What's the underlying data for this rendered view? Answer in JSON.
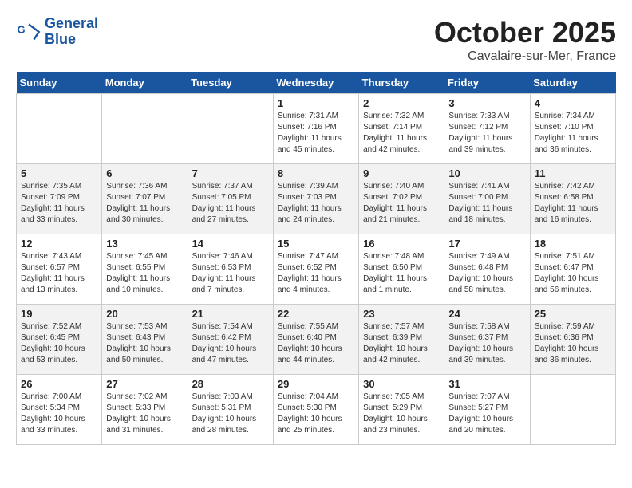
{
  "header": {
    "logo_line1": "General",
    "logo_line2": "Blue",
    "month": "October 2025",
    "location": "Cavalaire-sur-Mer, France"
  },
  "weekdays": [
    "Sunday",
    "Monday",
    "Tuesday",
    "Wednesday",
    "Thursday",
    "Friday",
    "Saturday"
  ],
  "weeks": [
    [
      {
        "day": "",
        "sunrise": "",
        "sunset": "",
        "daylight": ""
      },
      {
        "day": "",
        "sunrise": "",
        "sunset": "",
        "daylight": ""
      },
      {
        "day": "",
        "sunrise": "",
        "sunset": "",
        "daylight": ""
      },
      {
        "day": "1",
        "sunrise": "Sunrise: 7:31 AM",
        "sunset": "Sunset: 7:16 PM",
        "daylight": "Daylight: 11 hours and 45 minutes."
      },
      {
        "day": "2",
        "sunrise": "Sunrise: 7:32 AM",
        "sunset": "Sunset: 7:14 PM",
        "daylight": "Daylight: 11 hours and 42 minutes."
      },
      {
        "day": "3",
        "sunrise": "Sunrise: 7:33 AM",
        "sunset": "Sunset: 7:12 PM",
        "daylight": "Daylight: 11 hours and 39 minutes."
      },
      {
        "day": "4",
        "sunrise": "Sunrise: 7:34 AM",
        "sunset": "Sunset: 7:10 PM",
        "daylight": "Daylight: 11 hours and 36 minutes."
      }
    ],
    [
      {
        "day": "5",
        "sunrise": "Sunrise: 7:35 AM",
        "sunset": "Sunset: 7:09 PM",
        "daylight": "Daylight: 11 hours and 33 minutes."
      },
      {
        "day": "6",
        "sunrise": "Sunrise: 7:36 AM",
        "sunset": "Sunset: 7:07 PM",
        "daylight": "Daylight: 11 hours and 30 minutes."
      },
      {
        "day": "7",
        "sunrise": "Sunrise: 7:37 AM",
        "sunset": "Sunset: 7:05 PM",
        "daylight": "Daylight: 11 hours and 27 minutes."
      },
      {
        "day": "8",
        "sunrise": "Sunrise: 7:39 AM",
        "sunset": "Sunset: 7:03 PM",
        "daylight": "Daylight: 11 hours and 24 minutes."
      },
      {
        "day": "9",
        "sunrise": "Sunrise: 7:40 AM",
        "sunset": "Sunset: 7:02 PM",
        "daylight": "Daylight: 11 hours and 21 minutes."
      },
      {
        "day": "10",
        "sunrise": "Sunrise: 7:41 AM",
        "sunset": "Sunset: 7:00 PM",
        "daylight": "Daylight: 11 hours and 18 minutes."
      },
      {
        "day": "11",
        "sunrise": "Sunrise: 7:42 AM",
        "sunset": "Sunset: 6:58 PM",
        "daylight": "Daylight: 11 hours and 16 minutes."
      }
    ],
    [
      {
        "day": "12",
        "sunrise": "Sunrise: 7:43 AM",
        "sunset": "Sunset: 6:57 PM",
        "daylight": "Daylight: 11 hours and 13 minutes."
      },
      {
        "day": "13",
        "sunrise": "Sunrise: 7:45 AM",
        "sunset": "Sunset: 6:55 PM",
        "daylight": "Daylight: 11 hours and 10 minutes."
      },
      {
        "day": "14",
        "sunrise": "Sunrise: 7:46 AM",
        "sunset": "Sunset: 6:53 PM",
        "daylight": "Daylight: 11 hours and 7 minutes."
      },
      {
        "day": "15",
        "sunrise": "Sunrise: 7:47 AM",
        "sunset": "Sunset: 6:52 PM",
        "daylight": "Daylight: 11 hours and 4 minutes."
      },
      {
        "day": "16",
        "sunrise": "Sunrise: 7:48 AM",
        "sunset": "Sunset: 6:50 PM",
        "daylight": "Daylight: 11 hours and 1 minute."
      },
      {
        "day": "17",
        "sunrise": "Sunrise: 7:49 AM",
        "sunset": "Sunset: 6:48 PM",
        "daylight": "Daylight: 10 hours and 58 minutes."
      },
      {
        "day": "18",
        "sunrise": "Sunrise: 7:51 AM",
        "sunset": "Sunset: 6:47 PM",
        "daylight": "Daylight: 10 hours and 56 minutes."
      }
    ],
    [
      {
        "day": "19",
        "sunrise": "Sunrise: 7:52 AM",
        "sunset": "Sunset: 6:45 PM",
        "daylight": "Daylight: 10 hours and 53 minutes."
      },
      {
        "day": "20",
        "sunrise": "Sunrise: 7:53 AM",
        "sunset": "Sunset: 6:43 PM",
        "daylight": "Daylight: 10 hours and 50 minutes."
      },
      {
        "day": "21",
        "sunrise": "Sunrise: 7:54 AM",
        "sunset": "Sunset: 6:42 PM",
        "daylight": "Daylight: 10 hours and 47 minutes."
      },
      {
        "day": "22",
        "sunrise": "Sunrise: 7:55 AM",
        "sunset": "Sunset: 6:40 PM",
        "daylight": "Daylight: 10 hours and 44 minutes."
      },
      {
        "day": "23",
        "sunrise": "Sunrise: 7:57 AM",
        "sunset": "Sunset: 6:39 PM",
        "daylight": "Daylight: 10 hours and 42 minutes."
      },
      {
        "day": "24",
        "sunrise": "Sunrise: 7:58 AM",
        "sunset": "Sunset: 6:37 PM",
        "daylight": "Daylight: 10 hours and 39 minutes."
      },
      {
        "day": "25",
        "sunrise": "Sunrise: 7:59 AM",
        "sunset": "Sunset: 6:36 PM",
        "daylight": "Daylight: 10 hours and 36 minutes."
      }
    ],
    [
      {
        "day": "26",
        "sunrise": "Sunrise: 7:00 AM",
        "sunset": "Sunset: 5:34 PM",
        "daylight": "Daylight: 10 hours and 33 minutes."
      },
      {
        "day": "27",
        "sunrise": "Sunrise: 7:02 AM",
        "sunset": "Sunset: 5:33 PM",
        "daylight": "Daylight: 10 hours and 31 minutes."
      },
      {
        "day": "28",
        "sunrise": "Sunrise: 7:03 AM",
        "sunset": "Sunset: 5:31 PM",
        "daylight": "Daylight: 10 hours and 28 minutes."
      },
      {
        "day": "29",
        "sunrise": "Sunrise: 7:04 AM",
        "sunset": "Sunset: 5:30 PM",
        "daylight": "Daylight: 10 hours and 25 minutes."
      },
      {
        "day": "30",
        "sunrise": "Sunrise: 7:05 AM",
        "sunset": "Sunset: 5:29 PM",
        "daylight": "Daylight: 10 hours and 23 minutes."
      },
      {
        "day": "31",
        "sunrise": "Sunrise: 7:07 AM",
        "sunset": "Sunset: 5:27 PM",
        "daylight": "Daylight: 10 hours and 20 minutes."
      },
      {
        "day": "",
        "sunrise": "",
        "sunset": "",
        "daylight": ""
      }
    ]
  ]
}
